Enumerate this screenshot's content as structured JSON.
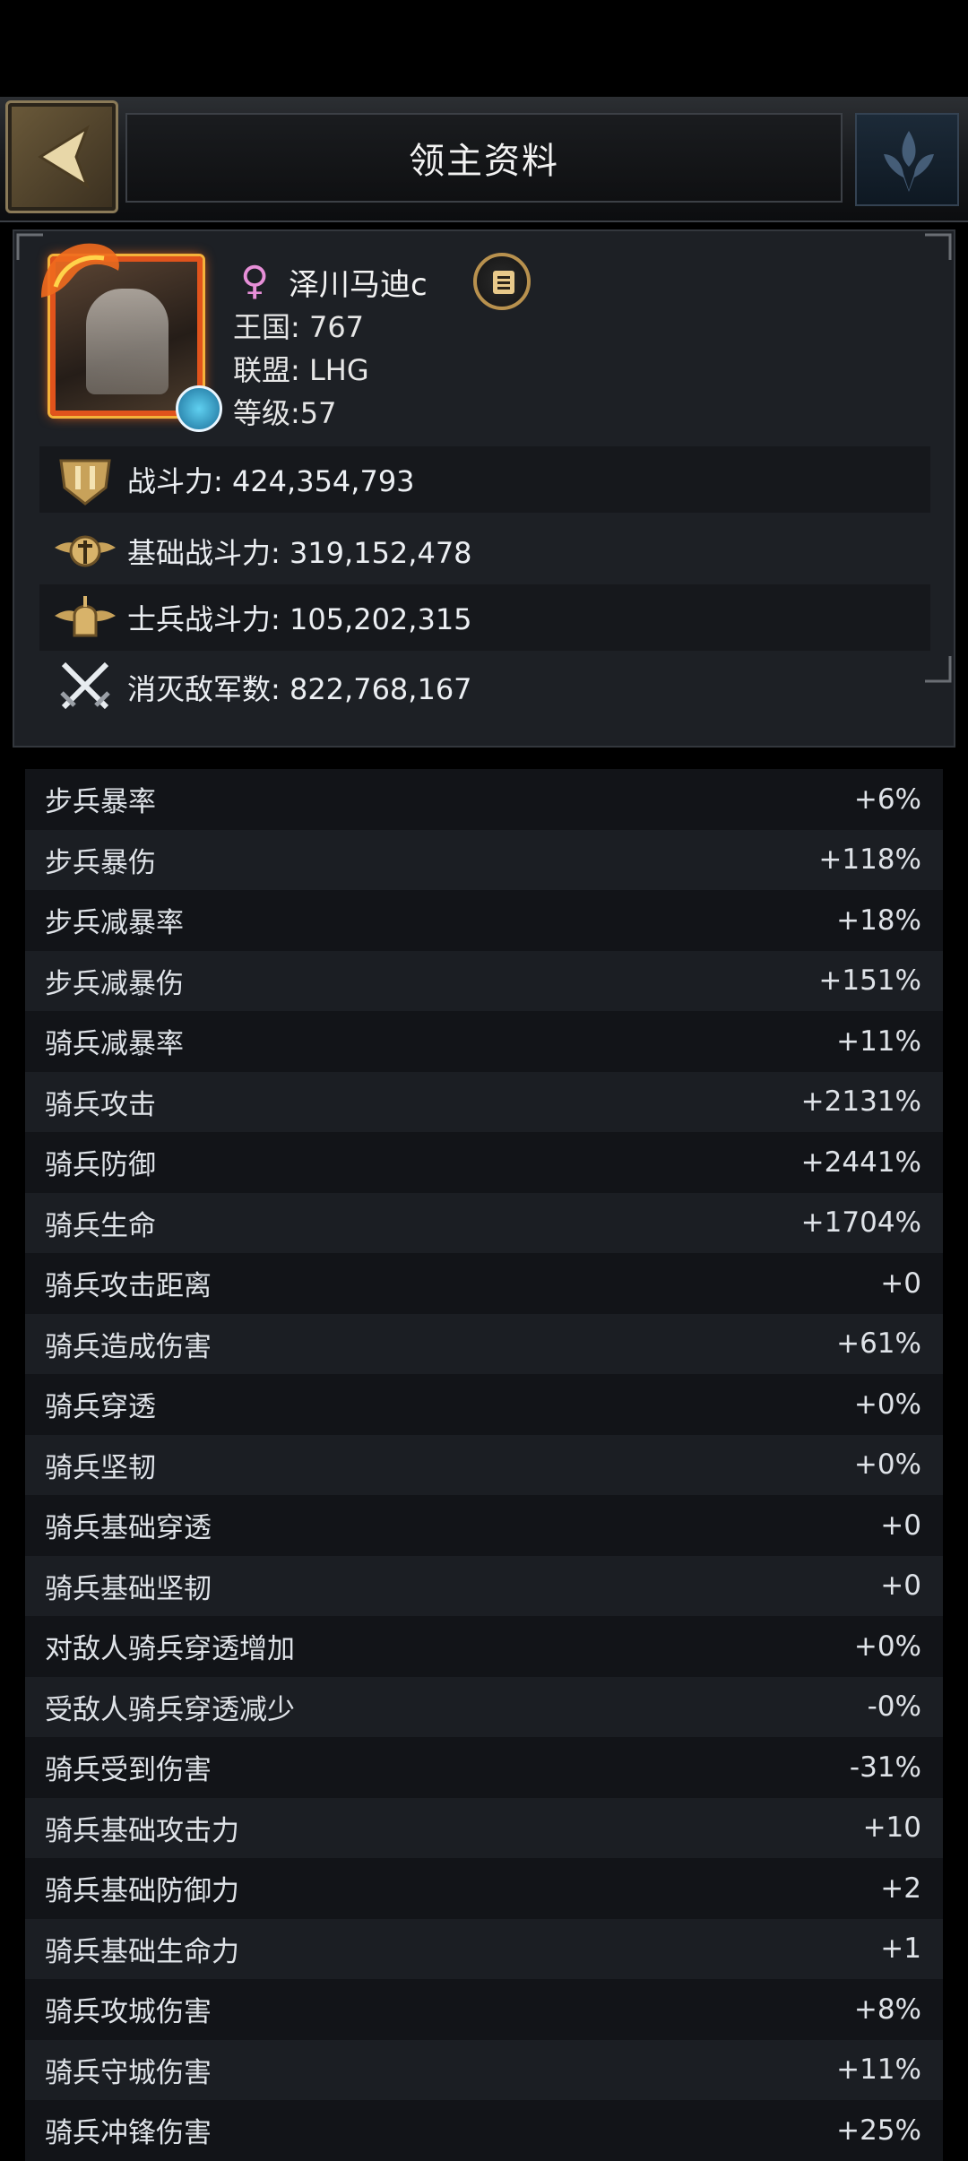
{
  "header": {
    "title": "领主资料"
  },
  "profile": {
    "name": "泽川马迪c",
    "kingdom": "王国:  767",
    "alliance": "联盟:  LHG",
    "level": "等级:57"
  },
  "stats": [
    {
      "icon": "power-shield-icon",
      "text": "战斗力: 424,354,793"
    },
    {
      "icon": "base-power-emblem-icon",
      "text": "基础战斗力: 319,152,478"
    },
    {
      "icon": "soldier-helmet-icon",
      "text": "士兵战斗力: 105,202,315"
    },
    {
      "icon": "crossed-swords-icon",
      "text": "消灭敌军数: 822,768,167"
    }
  ],
  "attributes": [
    {
      "label": "步兵暴率",
      "value": "+6%"
    },
    {
      "label": "步兵暴伤",
      "value": "+118%"
    },
    {
      "label": "步兵减暴率",
      "value": "+18%"
    },
    {
      "label": "步兵减暴伤",
      "value": "+151%"
    },
    {
      "label": "骑兵减暴率",
      "value": "+11%"
    },
    {
      "label": "骑兵攻击",
      "value": "+2131%"
    },
    {
      "label": "骑兵防御",
      "value": "+2441%"
    },
    {
      "label": "骑兵生命",
      "value": "+1704%"
    },
    {
      "label": "骑兵攻击距离",
      "value": "+0"
    },
    {
      "label": "骑兵造成伤害",
      "value": "+61%"
    },
    {
      "label": "骑兵穿透",
      "value": "+0%"
    },
    {
      "label": "骑兵坚韧",
      "value": "+0%"
    },
    {
      "label": "骑兵基础穿透",
      "value": "+0"
    },
    {
      "label": "骑兵基础坚韧",
      "value": "+0"
    },
    {
      "label": "对敌人骑兵穿透增加",
      "value": "+0%"
    },
    {
      "label": "受敌人骑兵穿透减少",
      "value": "-0%"
    },
    {
      "label": "骑兵受到伤害",
      "value": "-31%"
    },
    {
      "label": "骑兵基础攻击力",
      "value": "+10"
    },
    {
      "label": "骑兵基础防御力",
      "value": "+2"
    },
    {
      "label": "骑兵基础生命力",
      "value": "+1"
    },
    {
      "label": "骑兵攻城伤害",
      "value": "+8%"
    },
    {
      "label": "骑兵守城伤害",
      "value": "+11%"
    },
    {
      "label": "骑兵冲锋伤害",
      "value": "+25%"
    }
  ],
  "colors": {
    "accent_gold": "#b8914e",
    "female": "#e78fd8",
    "frame_orange": "#e0531c"
  }
}
